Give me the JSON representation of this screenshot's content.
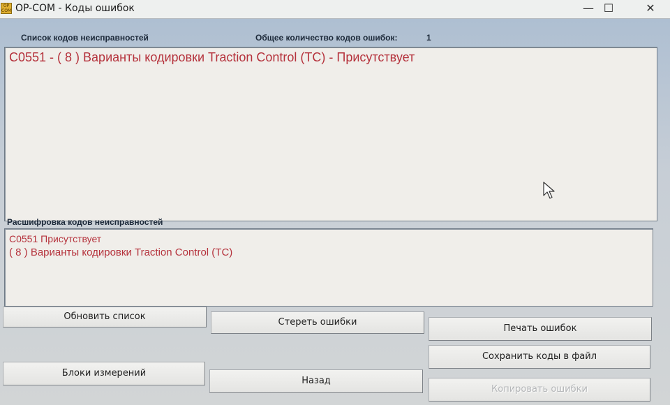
{
  "window": {
    "icon_text": "OP COM",
    "title": "OP-COM - Коды ошибок",
    "minimize": "—",
    "maximize": "☐",
    "close": "✕"
  },
  "codes_list": {
    "header": "Список кодов неисправностей",
    "count_label": "Общее количество кодов ошибок:",
    "count": "1",
    "items": [
      "C0551 - ( 8 )  Варианты кодировки Traction Control (TC) - Присутствует"
    ]
  },
  "decoding": {
    "header": "Расшифровка кодов неисправностей",
    "lines": [
      "C0551  Присутствует",
      "( 8 )  Варианты кодировки Traction Control (TC)"
    ]
  },
  "buttons": {
    "refresh": "Обновить список",
    "clear": "Стереть ошибки",
    "print": "Печать ошибок",
    "save": "Сохранить коды в файл",
    "measure": "Блоки измерений",
    "back": "Назад",
    "copy": "Копировать ошибки"
  },
  "colors": {
    "code_text": "#b5323c",
    "panel_bg": "#f0eeea"
  },
  "cursor_icon": "arrow-cursor-icon"
}
